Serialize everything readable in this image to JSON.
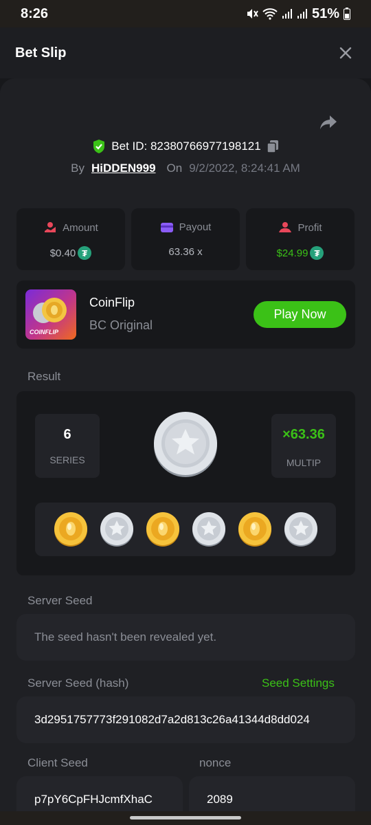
{
  "status": {
    "time": "8:26",
    "battery": "51%"
  },
  "header": {
    "title": "Bet Slip"
  },
  "bet": {
    "id_text": "Bet ID: 82380766977198121",
    "by_label": "By",
    "user": "HiDDEN999",
    "on_label": "On",
    "date": "9/2/2022, 8:24:41 AM"
  },
  "stats": {
    "amount_label": "Amount",
    "amount_value": "$0.40",
    "payout_label": "Payout",
    "payout_value": "63.36 x",
    "profit_label": "Profit",
    "profit_value": "$24.99",
    "currency_icon": "tether-icon"
  },
  "game": {
    "name": "CoinFlip",
    "subtitle": "BC Original",
    "thumb_label": "COINFLIP",
    "play_label": "Play Now"
  },
  "result": {
    "label": "Result",
    "series_value": "6",
    "series_label": "SERIES",
    "multiplier_value": "×63.36",
    "multiplier_label": "MULTIP",
    "big_coin": "silver-star",
    "coins": [
      "gold",
      "silver",
      "gold",
      "silver",
      "gold",
      "silver"
    ]
  },
  "server_seed": {
    "label": "Server Seed",
    "value": "The seed hasn't been revealed yet."
  },
  "server_seed_hash": {
    "label": "Server Seed (hash)",
    "settings_link": "Seed Settings",
    "value": "3d2951757773f291082d7a2d813c26a41344d8dd024"
  },
  "client_seed": {
    "label": "Client Seed",
    "value": "p7pY6CpFHJcmfXhaC"
  },
  "nonce": {
    "label": "nonce",
    "value": "2089"
  },
  "colors": {
    "accent_green": "#3bc117",
    "background": "#17181b",
    "panel": "#1f2024"
  }
}
